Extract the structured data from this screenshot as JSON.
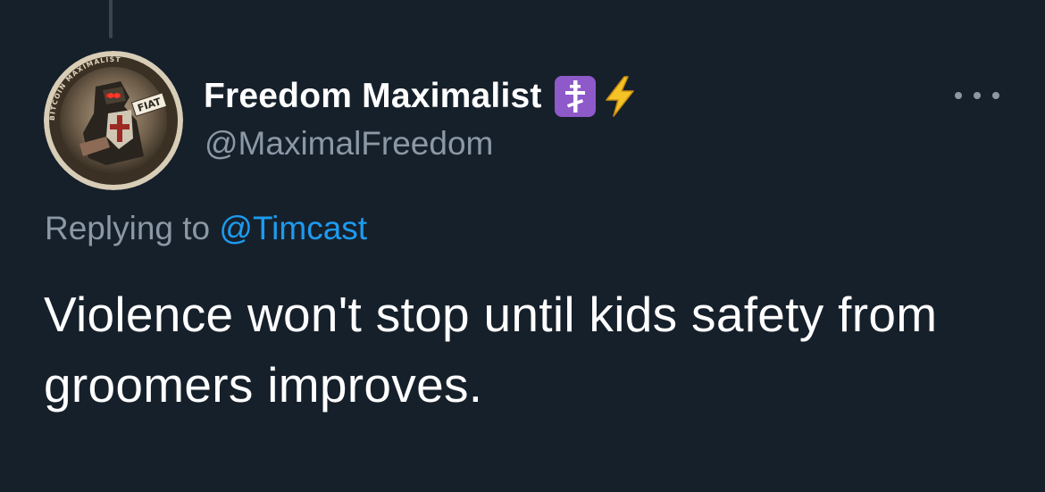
{
  "author": {
    "display_name": "Freedom Maximalist",
    "badges": [
      "orthodox-cross-emoji",
      "lightning-emoji"
    ],
    "handle": "@MaximalFreedom",
    "avatar_ring_text": "BITCOIN MAXIMALIST",
    "avatar_banner_text": "FIAT"
  },
  "reply": {
    "prefix": "Replying to",
    "mention": "@Timcast"
  },
  "tweet": {
    "text": "Violence won't stop until kids safety from groomers improves."
  },
  "colors": {
    "background": "#16202b",
    "primary_text": "#ffffff",
    "secondary_text": "#8b98a5",
    "link": "#1d9bf0",
    "badge_purple": "#8e59c9",
    "lightning": "#f5c325"
  }
}
